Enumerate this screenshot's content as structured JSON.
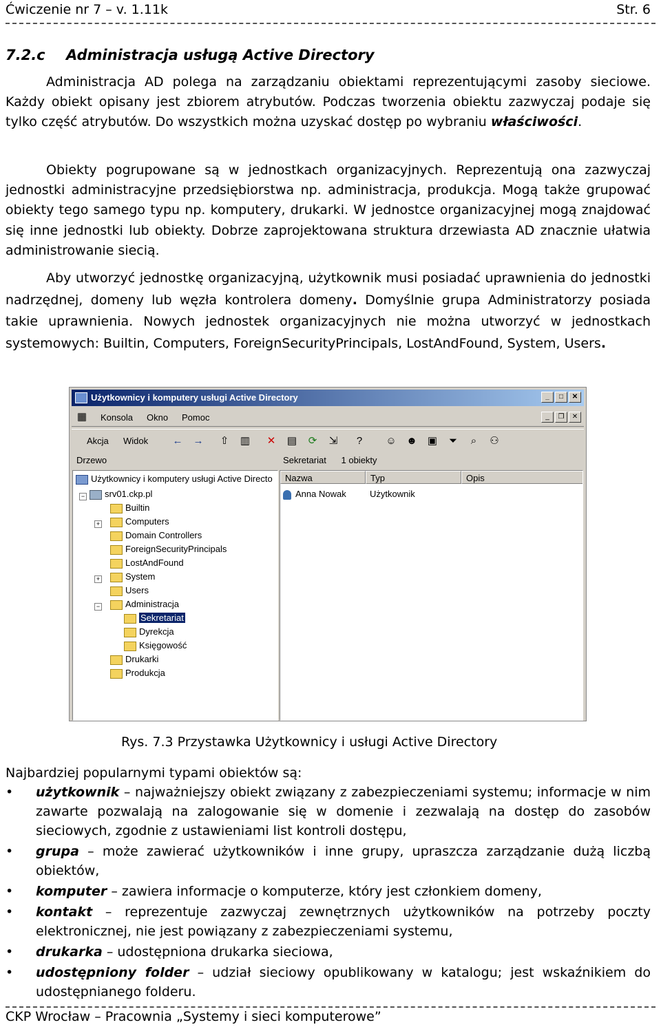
{
  "header": {
    "left": "Ćwiczenie nr 7 – v. 1.11k",
    "right": "Str. 6"
  },
  "section": {
    "number": "7.2.c",
    "title": "Administracja usługą Active Directory"
  },
  "para1": {
    "text": "Administracja AD polega na zarządzaniu obiektami reprezentującymi zasoby sieciowe. Każdy obiekt opisany jest zbiorem atrybutów. Podczas tworzenia obiektu zazwyczaj podaje się tylko część atrybutów. Do wszystkich można uzyskać dostęp po wybraniu ",
    "bold": "właściwości",
    "end": "."
  },
  "para2": {
    "text": "Obiekty pogrupowane są w jednostkach organizacyjnych. Reprezentują ona zazwyczaj jednostki administracyjne przedsiębiorstwa np. administracja, produkcja. Mogą także grupować obiekty tego samego typu np. komputery, drukarki. W jednostce organizacyjnej mogą znajdować się inne jednostki lub obiekty. Dobrze zaprojektowana struktura drzewiasta AD znacznie ułatwia administrowanie siecią."
  },
  "para3": {
    "a": "Aby utworzyć jednostkę organizacyjną, użytkownik musi posiadać uprawnienia do jednostki nadrzędnej, domeny lub węzła kontrolera domeny",
    "a_dot": ".",
    "b": " Domyślnie grupa Administratorzy posiada takie uprawnienia. Nowych jednostek organizacyjnych nie można utworzyć w jednostkach systemowych: Builtin, Computers, ForeignSecurityPrincipals, LostAndFound, System, Users",
    "b_dot": "."
  },
  "window": {
    "title": "Użytkownicy i komputery usługi Active Directory",
    "menu": [
      "Konsola",
      "Okno",
      "Pomoc"
    ],
    "action_menu": [
      "Akcja",
      "Widok"
    ],
    "tree_tab": "Drzewo",
    "right_header": {
      "title": "Sekretariat",
      "count": "1 obiekty"
    },
    "columns": [
      "Nazwa",
      "Typ",
      "Opis"
    ],
    "rows": [
      {
        "name": "Anna Nowak",
        "type": "Użytkownik",
        "desc": ""
      }
    ],
    "tree": {
      "root": "Użytkownicy i komputery usługi Active Directo",
      "domain": "srv01.ckp.pl",
      "items": [
        "Builtin",
        "Computers",
        "Domain Controllers",
        "ForeignSecurityPrincipals",
        "LostAndFound",
        "System",
        "Users",
        "Administracja"
      ],
      "sub_items": [
        "Sekretariat",
        "Dyrekcja",
        "Księgowość"
      ],
      "items_after": [
        "Drukarki",
        "Produkcja"
      ]
    }
  },
  "caption": "Rys. 7.3 Przystawka Użytkownicy i usługi Active Directory",
  "list_intro": "Najbardziej popularnymi typami obiektów są:",
  "bullets": [
    {
      "term": "użytkownik",
      "desc": " – najważniejszy obiekt związany z zabezpieczeniami systemu; informacje w nim zawarte pozwalają na zalogowanie się w domenie i zezwalają na dostęp do zasobów sieciowych, zgodnie z ustawieniami list kontroli dostępu,"
    },
    {
      "term": "grupa",
      "desc": " – może zawierać użytkowników i inne grupy, upraszcza zarządzanie dużą liczbą obiektów,"
    },
    {
      "term": "komputer",
      "desc": " – zawiera informacje o komputerze, który jest członkiem domeny,"
    },
    {
      "term": "kontakt",
      "desc": " – reprezentuje zazwyczaj zewnętrznych użytkowników na potrzeby poczty elektronicznej, nie jest powiązany z zabezpieczeniami systemu,"
    },
    {
      "term": "drukarka",
      "desc": " – udostępniona drukarka sieciowa,"
    },
    {
      "term": "udostępniony folder",
      "desc": " – udział sieciowy opublikowany w katalogu; jest wskaźnikiem do udostępnianego folderu."
    }
  ],
  "footer": "CKP Wrocław – Pracownia „Systemy i sieci komputerowe”"
}
